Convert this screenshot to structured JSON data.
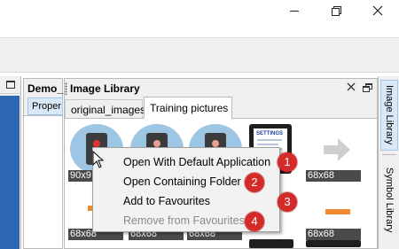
{
  "window": {
    "buttons": {
      "minimize": "minimize",
      "maximize": "restore",
      "close": "close"
    }
  },
  "demo_panel": {
    "title": "Demo_",
    "tab_label": "Proper"
  },
  "image_library": {
    "title": "Image Library",
    "tabs": [
      {
        "label": "original_images",
        "active": false
      },
      {
        "label": "Training pictures",
        "active": true
      }
    ],
    "thumbnails_row1": [
      {
        "label": "90x9",
        "image": "phone-record-icon"
      },
      {
        "label": "",
        "image": "phone-record-icon"
      },
      {
        "label": "",
        "image": "phone-record-icon"
      },
      {
        "label": "",
        "image": "settings-screenshot"
      },
      {
        "label": "68x68",
        "image": "arrow-right-icon"
      }
    ],
    "thumbnails_row2": [
      {
        "label": "68x68"
      },
      {
        "label": "68x68"
      },
      {
        "label": "68x68"
      },
      {
        "label": ""
      },
      {
        "label": "68x68"
      }
    ],
    "settings_thumb_text": "SETTINGS"
  },
  "right_sidebar": {
    "tabs": [
      "Image Library",
      "Symbol Library"
    ]
  },
  "context_menu": {
    "items": [
      {
        "label": "Open With Default Application",
        "enabled": true,
        "badge": "1"
      },
      {
        "label": "Open Containing Folder",
        "enabled": true,
        "badge": "2"
      },
      {
        "label": "Add to Favourites",
        "enabled": true,
        "badge": "3"
      },
      {
        "label": "Remove from Favourites",
        "enabled": false,
        "badge": "4"
      }
    ]
  },
  "colors": {
    "accent_blue": "#2d67b1",
    "badge_red": "#d42a2a",
    "thumb_circle": "#9cc6e4",
    "orange": "#f08a30"
  }
}
